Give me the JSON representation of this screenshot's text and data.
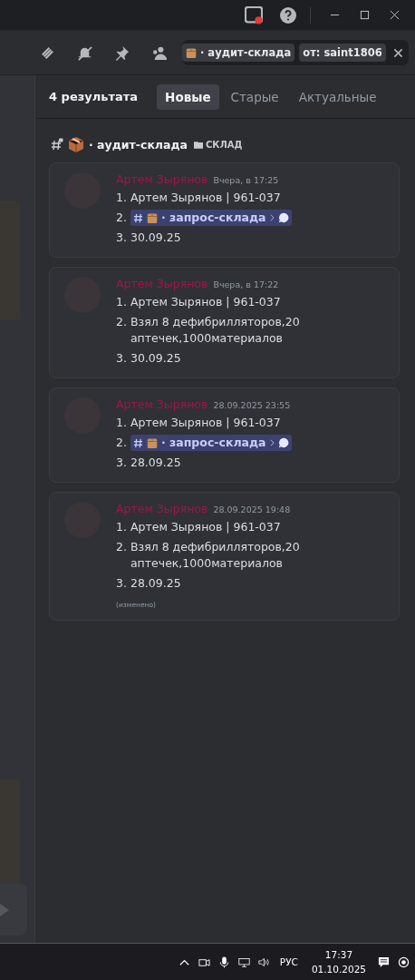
{
  "search": {
    "tags": [
      {
        "kind": "channel",
        "label": "· аудит-склада"
      },
      {
        "kind": "from",
        "label": "от: saint1806"
      }
    ]
  },
  "results": {
    "count": "4 результата",
    "sort_tabs": [
      {
        "label": "Новые",
        "selected": true
      },
      {
        "label": "Старые",
        "selected": false
      },
      {
        "label": "Актуальные",
        "selected": false
      }
    ]
  },
  "channel_header": {
    "name": "· аудит-склада",
    "category": "СКЛАД"
  },
  "messages": [
    {
      "author": "Артем Зырянов",
      "timestamp": "Вчера, в 17:25",
      "lines": [
        {
          "kind": "text",
          "number": "1.",
          "text": "Артем Зырянов | 961-037"
        },
        {
          "kind": "mention",
          "number": "2.",
          "text": "· запрос-склада"
        },
        {
          "kind": "text",
          "number": "3.",
          "text": "30.09.25"
        }
      ]
    },
    {
      "author": "Артем Зырянов",
      "timestamp": "Вчера, в 17:22",
      "lines": [
        {
          "kind": "text",
          "number": "1.",
          "text": "Артем Зырянов | 961-037"
        },
        {
          "kind": "text",
          "number": "2.",
          "text": "Взял 8 дефибрилляторов,20 аптечек,1000материалов"
        },
        {
          "kind": "text",
          "number": "3.",
          "text": "30.09.25"
        }
      ]
    },
    {
      "author": "Артем Зырянов",
      "timestamp": "28.09.2025 23:55",
      "lines": [
        {
          "kind": "text",
          "number": "1.",
          "text": "Артем Зырянов | 961-037"
        },
        {
          "kind": "mention",
          "number": "2.",
          "text": "· запрос-склада"
        },
        {
          "kind": "text",
          "number": "3.",
          "text": "28.09.25"
        }
      ]
    },
    {
      "author": "Артем Зырянов",
      "timestamp": "28.09.2025 19:48",
      "lines": [
        {
          "kind": "text",
          "number": "1.",
          "text": "Артем Зырянов | 961-037"
        },
        {
          "kind": "text",
          "number": "2.",
          "text": "Взял 8 дефибрилляторов,20 аптечек,1000материалов"
        },
        {
          "kind": "text",
          "number": "3.",
          "text": "28.09.25"
        }
      ],
      "edited": "(изменено)"
    }
  ],
  "taskbar": {
    "language": "РУС",
    "time": "17:37",
    "date": "01.10.2025"
  }
}
